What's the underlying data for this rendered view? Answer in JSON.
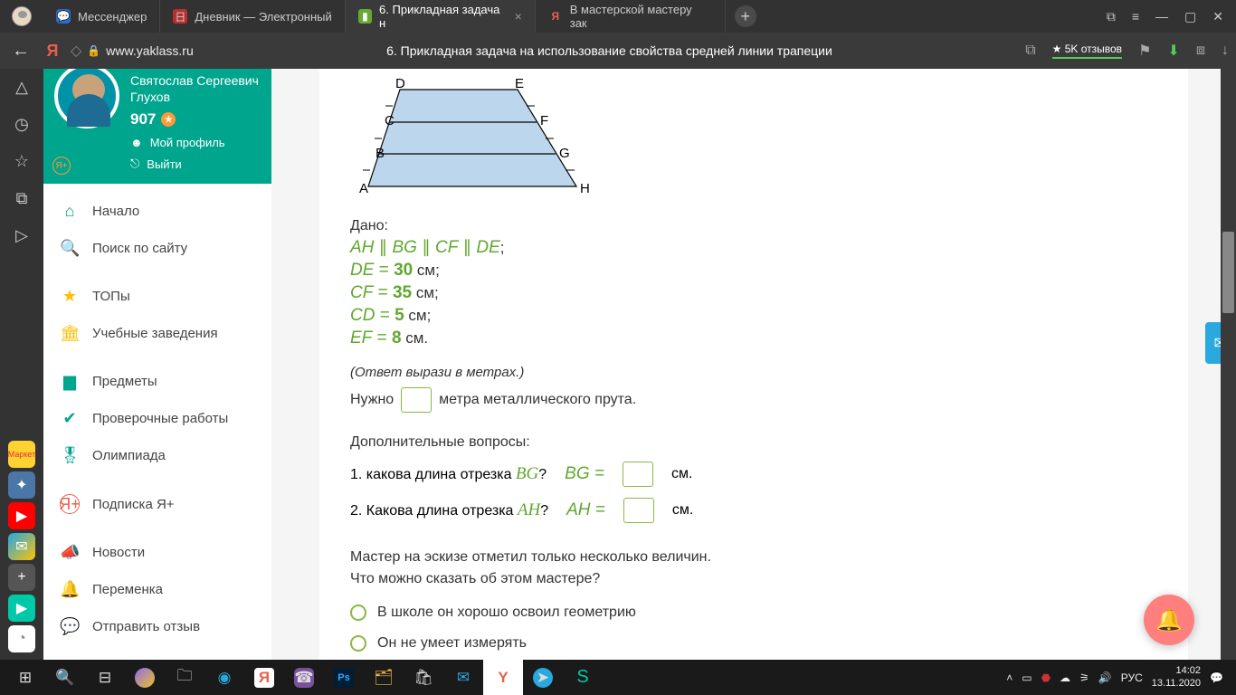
{
  "tabs": {
    "t1": "Мессенджер",
    "t2": "Дневник — Электронный",
    "t3": "6. Прикладная задача н",
    "t4": "В мастерской мастеру зак"
  },
  "url": "www.yaklass.ru",
  "pageTitle": "6. Прикладная задача на использование свойства средней линии трапеции",
  "rating": "★ 5K отзывов",
  "profile": {
    "name": "Святослав Сергеевич Глухов",
    "score": "907",
    "myProfile": "Мой профиль",
    "logout": "Выйти"
  },
  "nav": {
    "home": "Начало",
    "search": "Поиск по сайту",
    "tops": "ТОПы",
    "uni": "Учебные заведения",
    "subjects": "Предметы",
    "tests": "Проверочные работы",
    "olymp": "Олимпиада",
    "yaplus": "Подписка Я+",
    "news": "Новости",
    "break": "Переменка",
    "feedback": "Отправить отзыв"
  },
  "figure": {
    "labels": {
      "A": "A",
      "B": "B",
      "C": "C",
      "D": "D",
      "E": "E",
      "F": "F",
      "G": "G",
      "H": "H"
    }
  },
  "given": {
    "title": "Дано:",
    "parallel_parts": {
      "AH": "AH",
      "BG": "BG",
      "CF": "CF",
      "DE": "DE"
    },
    "de": "DE",
    "de_eq": " = ",
    "de_val": "30",
    "de_unit": " см;",
    "cf": "CF",
    "cf_val": "35",
    "cf_unit": " см;",
    "cd": "CD",
    "cd_val": "5",
    "cd_unit": " см;",
    "ef": "EF",
    "ef_val": "8",
    "ef_unit": " см."
  },
  "answer": {
    "hint": "(Ответ вырази в метрах.)",
    "prefix": " Нужно ",
    "suffix": " метра металлического прута."
  },
  "addq": {
    "title": "Дополнительные вопросы:",
    "q1_text_a": "1. какова длина отрезка ",
    "q1_seg": "BG",
    "q1_after": "?",
    "q1_eq_left": "BG",
    "q1_eq": " = ",
    "q1_unit": " см.",
    "q2_text_a": "2. Какова длина отрезка ",
    "q2_seg": "AH",
    "q2_after": "?",
    "q2_eq_left": "AH",
    "q2_unit": " см."
  },
  "master": {
    "line1": "Мастер на эскизе отметил только несколько величин.",
    "line2": "Что можно сказать об этом мастере?",
    "opt1": "В школе он хорошо освоил геометрию",
    "opt2": "Он не умеет измерять"
  },
  "tray": {
    "lang": "РУС",
    "time": "14:02",
    "date": "13.11.2020"
  }
}
